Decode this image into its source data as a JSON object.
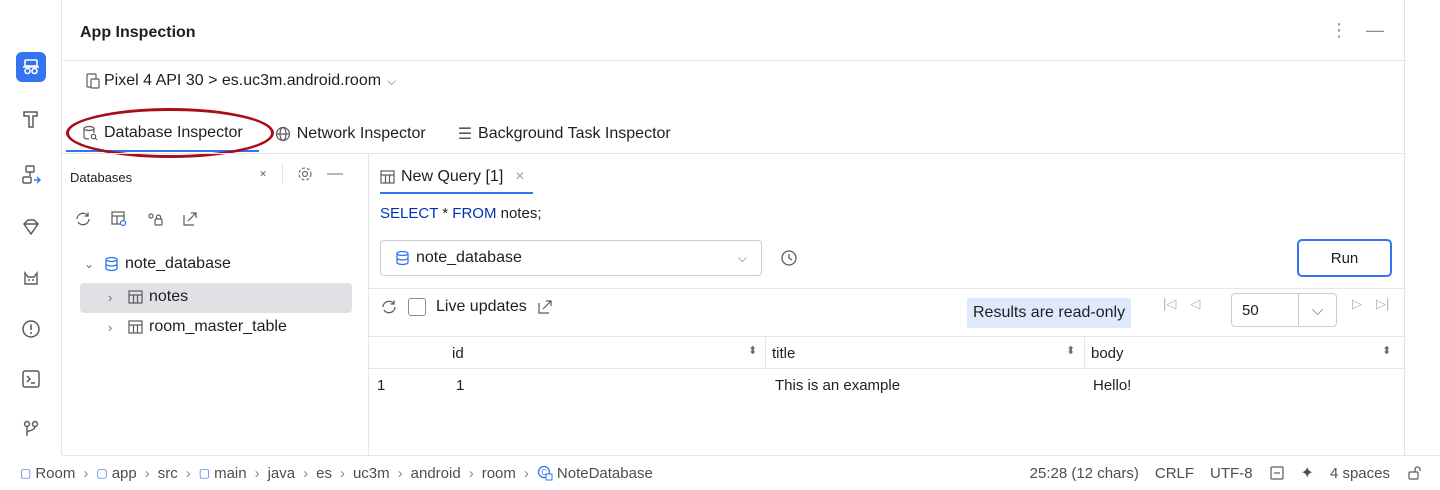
{
  "panel": {
    "title": "App Inspection"
  },
  "device": {
    "label": "Pixel 4 API 30 > es.uc3m.android.room"
  },
  "tabs": [
    {
      "label": "Database Inspector"
    },
    {
      "label": "Network Inspector"
    },
    {
      "label": "Background Task Inspector"
    }
  ],
  "databases": {
    "header": "Databases",
    "tree": [
      {
        "label": "note_database"
      },
      {
        "label": "notes"
      },
      {
        "label": "room_master_table"
      }
    ]
  },
  "query": {
    "tab_label": "New Query [1]",
    "sql_keyword1": "SELECT",
    "sql_star": "*",
    "sql_keyword2": "FROM",
    "sql_rest": "notes;",
    "db_selected": "note_database",
    "run_label": "Run"
  },
  "results": {
    "live_updates_label": "Live updates",
    "readonly_label": "Results are read-only",
    "page_size": "50",
    "columns": [
      "id",
      "title",
      "body"
    ],
    "rows": [
      {
        "row_num": "1",
        "id": "1",
        "title": "This is an example",
        "body": "Hello!"
      }
    ]
  },
  "statusbar": {
    "breadcrumbs": [
      "Room",
      "app",
      "src",
      "main",
      "java",
      "es",
      "uc3m",
      "android",
      "room",
      "NoteDatabase"
    ],
    "position": "25:28 (12 chars)",
    "line_ending": "CRLF",
    "encoding": "UTF-8",
    "indent": "4 spaces"
  },
  "colors": {
    "accent": "#3574f0",
    "highlight_oval": "#a80d18",
    "readonly_bg": "#dfe9fc",
    "sql_keyword": "#0033b3"
  }
}
